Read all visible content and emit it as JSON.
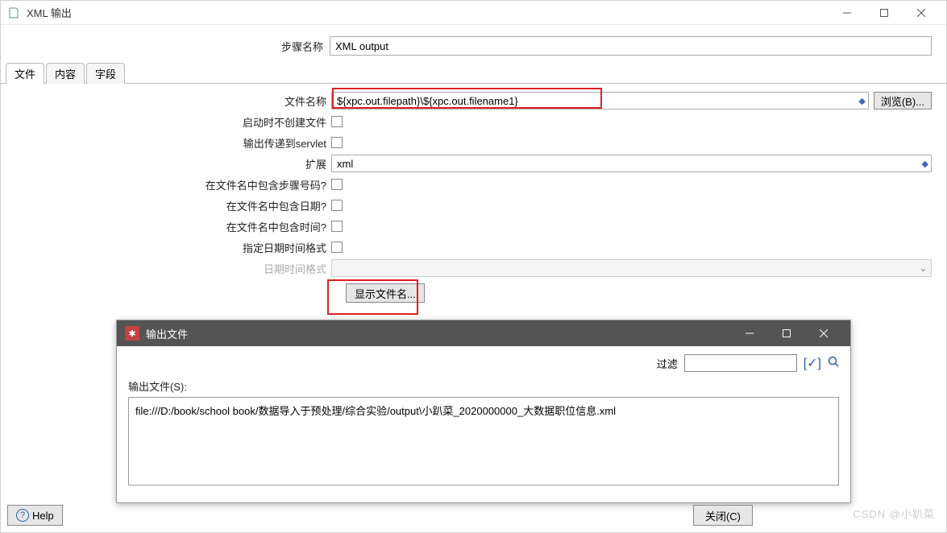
{
  "window": {
    "title": "XML 输出",
    "step_label": "步骤名称",
    "step_value": "XML output"
  },
  "tabs": [
    "文件",
    "内容",
    "字段"
  ],
  "form": {
    "filename_label": "文件名称",
    "filename_value": "${xpc.out.filepath}\\${xpc.out.filename1}",
    "browse_label": "浏览(B)...",
    "no_create_label": "启动时不创建文件",
    "servlet_label": "输出传递到servlet",
    "ext_label": "扩展",
    "ext_value": "xml",
    "inc_step_label": "在文件名中包含步骤号码?",
    "inc_date_label": "在文件名中包含日期?",
    "inc_time_label": "在文件名中包含时间?",
    "spec_fmt_label": "指定日期时间格式",
    "fmt_label": "日期时间格式",
    "show_filename_label": "显示文件名..."
  },
  "dialog": {
    "title": "输出文件",
    "filter_label": "过滤",
    "output_label": "输出文件(S):",
    "output_value": "file:///D:/book/school book/数据导入于预处理/综合实验/output\\小趴菜_2020000000_大数据职位信息.xml",
    "close_label": "关闭(C)"
  },
  "help_label": "Help",
  "watermark": "CSDN @小趴菜"
}
